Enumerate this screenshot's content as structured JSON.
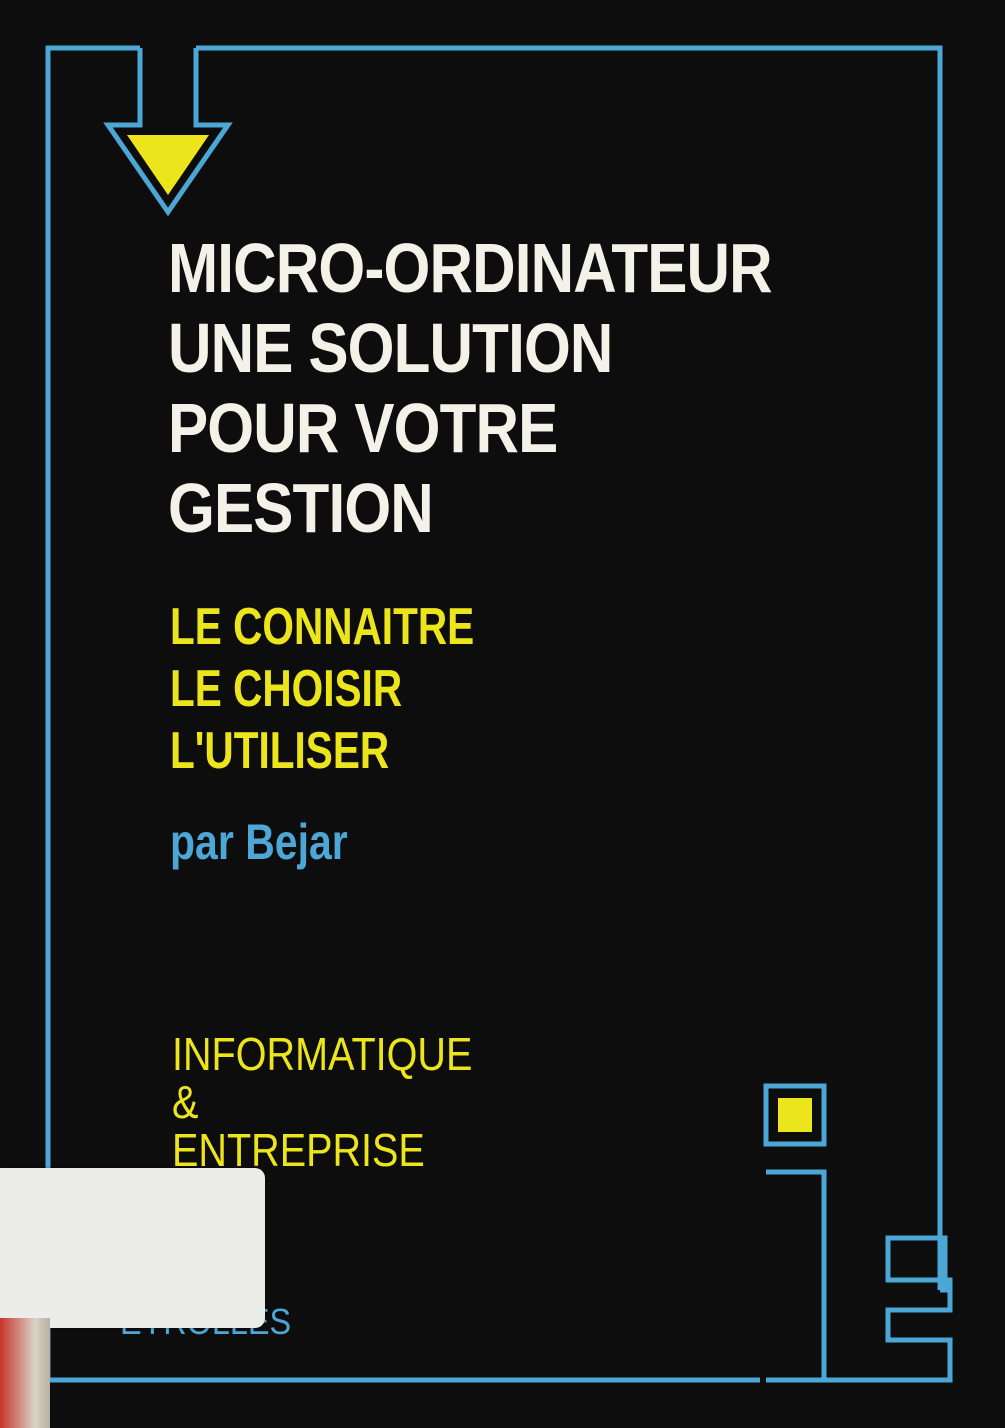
{
  "cover": {
    "title_lines": [
      "MICRO-ORDINATEUR",
      "UNE SOLUTION",
      "POUR VOTRE",
      "GESTION"
    ],
    "subtitle_lines": [
      "LE CONNAITRE",
      "LE CHOISIR",
      "L'UTILISER"
    ],
    "author": "par Bejar",
    "series_lines": [
      "INFORMATIQUE",
      "&",
      "ENTREPRISE"
    ],
    "publisher": "EYROLLES"
  },
  "colors": {
    "background": "#0d0d0d",
    "frame": "#4ca6d6",
    "accent_yellow": "#ece51c",
    "title_white": "#f4f1e8"
  },
  "icons": [
    "arrow-down-icon",
    "series-logo-ie-icon"
  ]
}
